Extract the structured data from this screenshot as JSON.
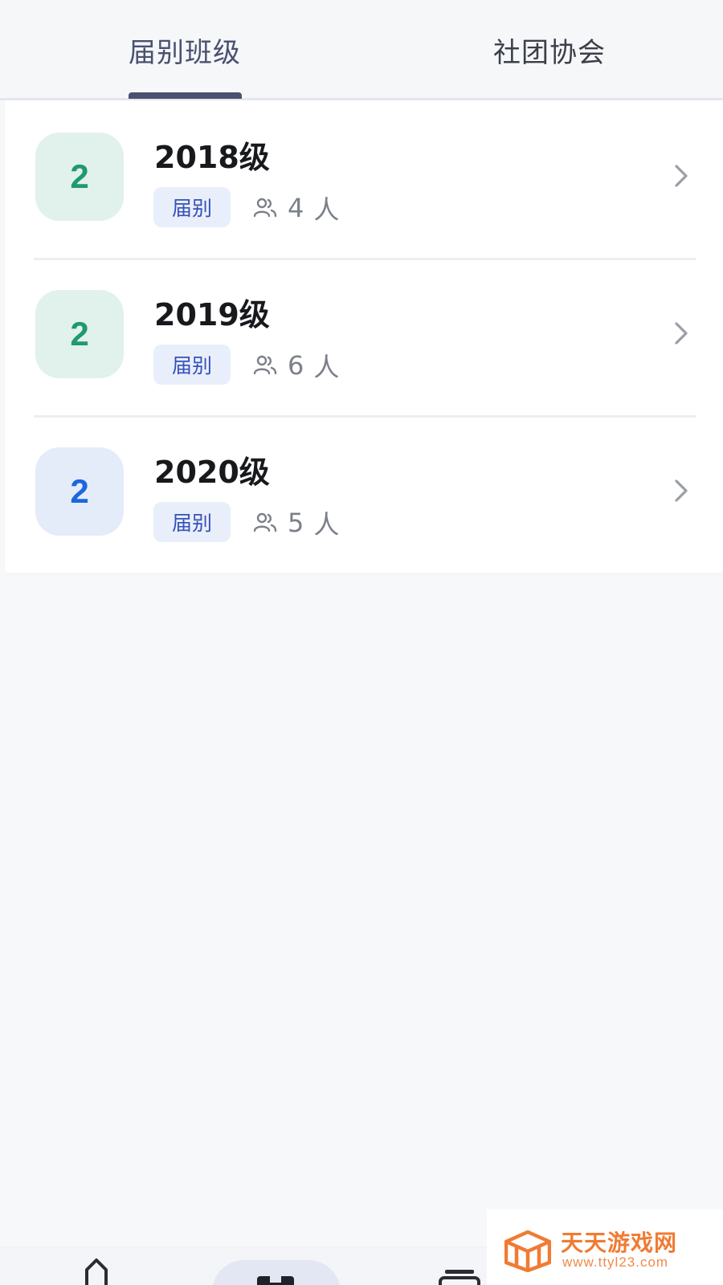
{
  "tabs": [
    {
      "label": "届别班级",
      "active": true
    },
    {
      "label": "社团协会",
      "active": false
    }
  ],
  "list": [
    {
      "avatar": "2",
      "title": "2018级",
      "tag": "届别",
      "count": "4",
      "unit": "人",
      "avatar_bg": "#e1f1ec",
      "avatar_color": "#1f9a6d"
    },
    {
      "avatar": "2",
      "title": "2019级",
      "tag": "届别",
      "count": "6",
      "unit": "人",
      "avatar_bg": "#e1f1ec",
      "avatar_color": "#1f9a6d"
    },
    {
      "avatar": "2",
      "title": "2020级",
      "tag": "届别",
      "count": "5",
      "unit": "人",
      "avatar_bg": "#e4ecfa",
      "avatar_color": "#1c67dd"
    }
  ],
  "bottom_nav": {
    "items": [
      "home-icon",
      "classes-icon",
      "profile-icon"
    ],
    "active": "classes-icon"
  },
  "watermark": {
    "title": "天天游戏网",
    "url": "www.ttyl23.com"
  },
  "colors": {
    "tab_accent": "#4a5070",
    "tag_bg": "#e9eefb",
    "tag_text": "#3552b8",
    "watermark_orange": "#f07b33"
  }
}
